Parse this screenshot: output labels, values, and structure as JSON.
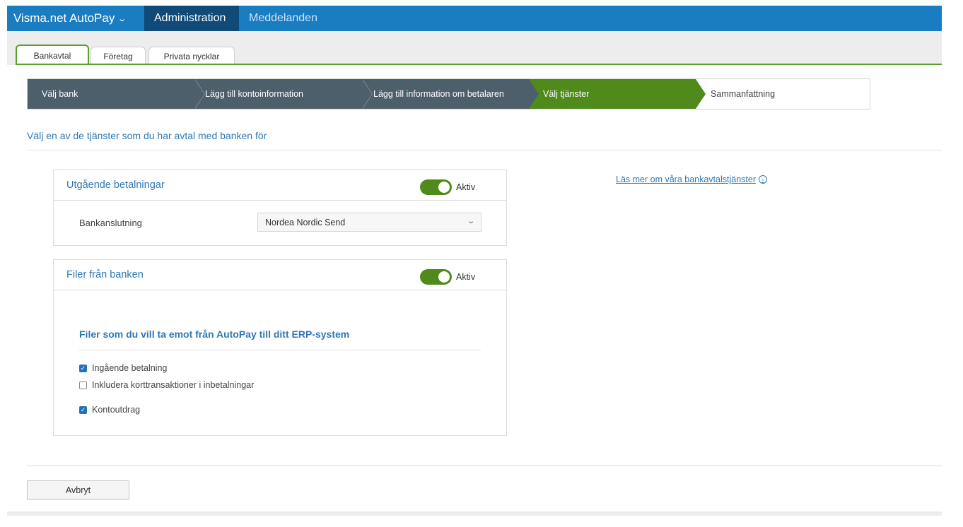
{
  "topbar": {
    "brand": "Visma.net AutoPay",
    "nav": [
      "Administration",
      "Meddelanden"
    ]
  },
  "tabs": [
    "Bankavtal",
    "Företag",
    "Privata nycklar"
  ],
  "wizard": {
    "steps": [
      "Välj bank",
      "Lägg till kontoinformation",
      "Lägg till information om betalaren",
      "Välj tjänster",
      "Sammanfattning"
    ],
    "current_index": 3
  },
  "intro": "Välj en av de tjänster som du har avtal med banken för",
  "panel_outgoing": {
    "title": "Utgående betalningar",
    "toggle_label": "Aktiv",
    "toggle_on": true,
    "row_label": "Bankanslutning",
    "select_value": "Nordea Nordic Send"
  },
  "panel_files": {
    "title": "Filer från banken",
    "toggle_label": "Aktiv",
    "toggle_on": true,
    "subhead": "Filer som du vill ta emot från AutoPay till ditt ERP-system",
    "options": [
      {
        "label": "Ingående betalning",
        "checked": true
      },
      {
        "label": "Inkludera korttransaktioner i inbetalningar",
        "checked": false
      },
      {
        "label": "Kontoutdrag",
        "checked": true
      }
    ]
  },
  "link": "Läs mer om våra bankavtalstjänster",
  "cancel_button": "Avbryt",
  "colors": {
    "topbar": "#1a7dc2",
    "nav_active": "#0f4a78",
    "step_done": "#4d5f6b",
    "step_current": "#4f8a1b",
    "accent_text": "#2f78b4",
    "tab_line": "#5aa02c"
  },
  "icons": {
    "brand_chevron": "chevron-down-icon",
    "select_chevron": "chevron-down-icon",
    "info": "info-circle-icon",
    "check": "checkmark-icon"
  }
}
